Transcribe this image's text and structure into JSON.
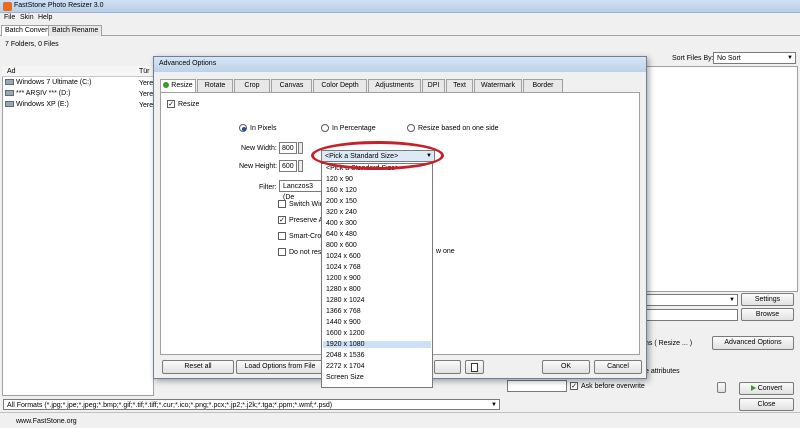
{
  "app": {
    "title": "FastStone Photo Resizer 3.0"
  },
  "menu": [
    "File",
    "Skin",
    "Help"
  ],
  "main_tabs": [
    "Batch Convert",
    "Batch Rename"
  ],
  "folder_count": "7 Folders, 0 Files",
  "tree": {
    "col_name": "Ad",
    "col_type": "Tür",
    "drives": [
      {
        "name": "Windows 7 Ultimate (C:)",
        "type": "Yerel"
      },
      {
        "name": "*** ARŞIV *** (D:)",
        "type": "Yerel"
      },
      {
        "name": "Windows XP (E:)",
        "type": "Yerel"
      }
    ]
  },
  "sort": {
    "label": "Sort Files By:",
    "value": "No Sort"
  },
  "formats": "All Formats (*.jpg;*.jpe;*.jpeg;*.bmp;*.gif;*.tif;*.tiff;*.cur;*.ico;*.png;*.pcx;*.jp2;*.j2k;*.tga;*.ppm;*.wmf;*.psd)",
  "right_panel": {
    "settings": "Settings",
    "browse": "Browse",
    "advanced_partial": "ns ( Resize ... )",
    "advanced_options": "Advanced Options",
    "attributes_partial": "e attributes",
    "ask_overwrite": "Ask before overwrite",
    "convert": "Convert",
    "close": "Close"
  },
  "status": {
    "website": "www.FastStone.org"
  },
  "dialog": {
    "title": "Advanced Options",
    "tabs": [
      "Resize",
      "Rotate",
      "Crop",
      "Canvas",
      "Color Depth",
      "Adjustments",
      "DPI",
      "Text",
      "Watermark",
      "Border"
    ],
    "resize_checkbox": "Resize",
    "radio_pixels": "In Pixels",
    "radio_percentage": "In Percentage",
    "radio_one_side": "Resize based on one side",
    "new_width_label": "New Width:",
    "new_width": "800",
    "new_height_label": "New Height:",
    "new_height": "600",
    "standard_size": "<Pick a Standard Size>",
    "filter_label": "Filter:",
    "filter_value": "Lanczos3 (De",
    "switch_partial": "Switch Wid",
    "preserve_partial": "Preserve A",
    "smartcrop_partial": "Smart-Crop",
    "donot_partial": "Do not resiz",
    "new_one_partial": "w one",
    "reset_all": "Reset all",
    "load_options": "Load Options from File",
    "ok": "OK",
    "cancel": "Cancel"
  },
  "size_options": [
    "<Pick a Standard Size>",
    "120 x 90",
    "160 x 120",
    "200 x 150",
    "320 x 240",
    "400 x 300",
    "640 x 480",
    "800 x 600",
    "1024 x 600",
    "1024 x 768",
    "1200 x 900",
    "1280 x 800",
    "1280 x 1024",
    "1366 x 768",
    "1440 x 900",
    "1600 x 1200",
    "1920 x 1080",
    "2048 x 1536",
    "2272 x 1704",
    "Screen Size"
  ],
  "selected_size": "1920 x 1080"
}
